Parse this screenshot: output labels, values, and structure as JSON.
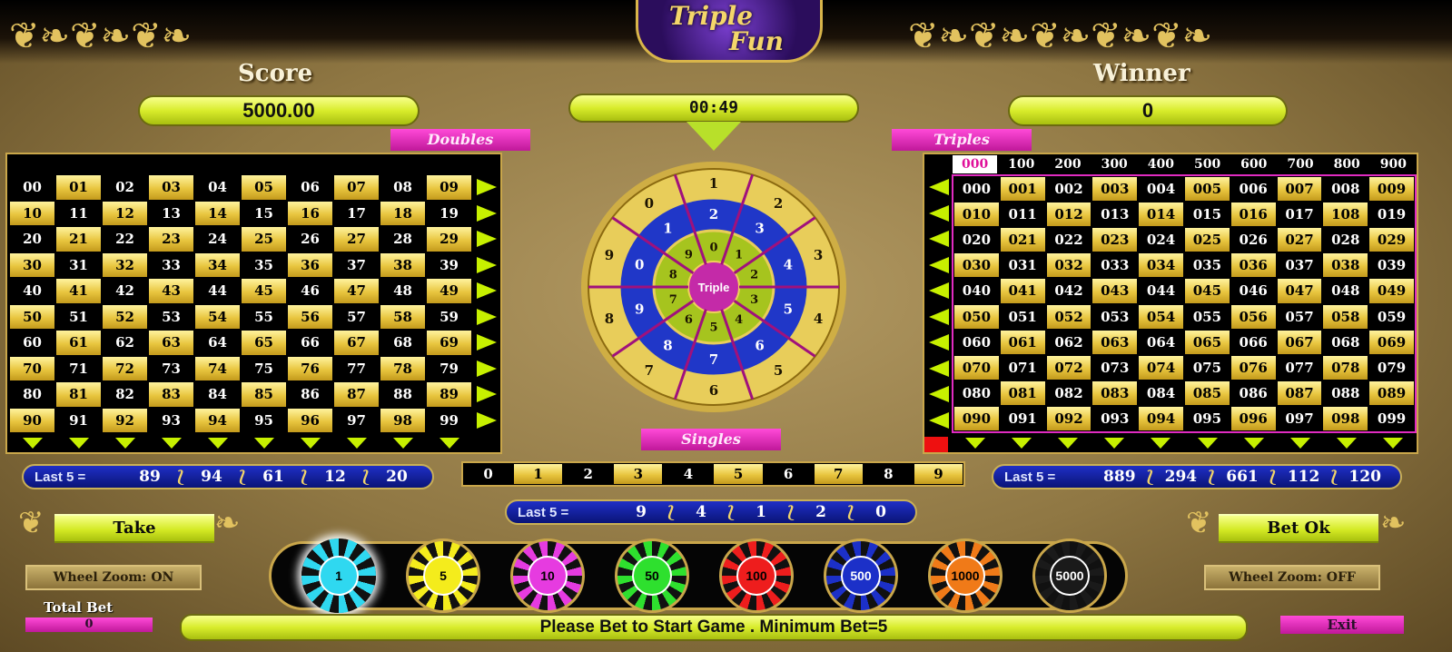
{
  "logo": {
    "line1": "Triple",
    "line2": "Fun"
  },
  "score": {
    "label": "Score",
    "value": "5000.00"
  },
  "timer": {
    "value": "00:49"
  },
  "winner": {
    "label": "Winner",
    "value": "0"
  },
  "tags": {
    "doubles": "Doubles",
    "triples": "Triples",
    "singles": "Singles"
  },
  "doubles_grid": {
    "rows": [
      [
        "00",
        "01",
        "02",
        "03",
        "04",
        "05",
        "06",
        "07",
        "08",
        "09"
      ],
      [
        "10",
        "11",
        "12",
        "13",
        "14",
        "15",
        "16",
        "17",
        "18",
        "19"
      ],
      [
        "20",
        "21",
        "22",
        "23",
        "24",
        "25",
        "26",
        "27",
        "28",
        "29"
      ],
      [
        "30",
        "31",
        "32",
        "33",
        "34",
        "35",
        "36",
        "37",
        "38",
        "39"
      ],
      [
        "40",
        "41",
        "42",
        "43",
        "44",
        "45",
        "46",
        "47",
        "48",
        "49"
      ],
      [
        "50",
        "51",
        "52",
        "53",
        "54",
        "55",
        "56",
        "57",
        "58",
        "59"
      ],
      [
        "60",
        "61",
        "62",
        "63",
        "64",
        "65",
        "66",
        "67",
        "68",
        "69"
      ],
      [
        "70",
        "71",
        "72",
        "73",
        "74",
        "75",
        "76",
        "77",
        "78",
        "79"
      ],
      [
        "80",
        "81",
        "82",
        "83",
        "84",
        "85",
        "86",
        "87",
        "88",
        "89"
      ],
      [
        "90",
        "91",
        "92",
        "93",
        "94",
        "95",
        "96",
        "97",
        "98",
        "99"
      ]
    ]
  },
  "triples_grid": {
    "headers": [
      "000",
      "100",
      "200",
      "300",
      "400",
      "500",
      "600",
      "700",
      "800",
      "900"
    ],
    "selected_header": 0,
    "rows": [
      [
        "000",
        "001",
        "002",
        "003",
        "004",
        "005",
        "006",
        "007",
        "008",
        "009"
      ],
      [
        "010",
        "011",
        "012",
        "013",
        "014",
        "015",
        "016",
        "017",
        "108",
        "019"
      ],
      [
        "020",
        "021",
        "022",
        "023",
        "024",
        "025",
        "026",
        "027",
        "028",
        "029"
      ],
      [
        "030",
        "031",
        "032",
        "033",
        "034",
        "035",
        "036",
        "037",
        "038",
        "039"
      ],
      [
        "040",
        "041",
        "042",
        "043",
        "044",
        "045",
        "046",
        "047",
        "048",
        "049"
      ],
      [
        "050",
        "051",
        "052",
        "053",
        "054",
        "055",
        "056",
        "057",
        "058",
        "059"
      ],
      [
        "060",
        "061",
        "062",
        "063",
        "064",
        "065",
        "066",
        "067",
        "068",
        "069"
      ],
      [
        "070",
        "071",
        "072",
        "073",
        "074",
        "075",
        "076",
        "077",
        "078",
        "079"
      ],
      [
        "080",
        "081",
        "082",
        "083",
        "084",
        "085",
        "086",
        "087",
        "088",
        "089"
      ],
      [
        "090",
        "091",
        "092",
        "093",
        "094",
        "095",
        "096",
        "097",
        "098",
        "099"
      ]
    ]
  },
  "wheel": {
    "center_label": "Triple",
    "outer": [
      "1",
      "2",
      "3",
      "4",
      "5",
      "6",
      "7",
      "8",
      "9",
      "0"
    ],
    "middle": [
      "2",
      "3",
      "4",
      "5",
      "6",
      "7",
      "8",
      "9",
      "0",
      "1"
    ],
    "inner": [
      "0",
      "1",
      "2",
      "3",
      "4",
      "5",
      "6",
      "7",
      "8",
      "9"
    ]
  },
  "singles": [
    "0",
    "1",
    "2",
    "3",
    "4",
    "5",
    "6",
    "7",
    "8",
    "9"
  ],
  "last5_doubles": {
    "label": "Last 5 =",
    "values": [
      "89",
      "94",
      "61",
      "12",
      "20"
    ]
  },
  "last5_triples": {
    "label": "Last 5 =",
    "values": [
      "889",
      "294",
      "661",
      "112",
      "120"
    ]
  },
  "last5_singles": {
    "label": "Last 5 =",
    "values": [
      "9",
      "4",
      "1",
      "2",
      "0"
    ]
  },
  "buttons": {
    "take": "Take",
    "bet_ok": "Bet Ok",
    "exit": "Exit"
  },
  "zoom": {
    "left": "Wheel Zoom: ON",
    "right": "Wheel Zoom: OFF"
  },
  "total_bet": {
    "label": "Total Bet",
    "value": "0"
  },
  "status_message": "Please Bet to Start Game . Minimum Bet=5",
  "chips": [
    {
      "value": "1",
      "color": "#2fd8f0",
      "selected": true
    },
    {
      "value": "5",
      "color": "#f4ec1c",
      "selected": false
    },
    {
      "value": "10",
      "color": "#e63be0",
      "selected": false
    },
    {
      "value": "50",
      "color": "#2ee02e",
      "selected": false
    },
    {
      "value": "100",
      "color": "#ee1d1d",
      "selected": false
    },
    {
      "value": "500",
      "color": "#1c30c8",
      "selected": false
    },
    {
      "value": "1000",
      "color": "#f07a18",
      "selected": false
    },
    {
      "value": "5000",
      "color": "#1a1a1a",
      "selected": false
    }
  ]
}
